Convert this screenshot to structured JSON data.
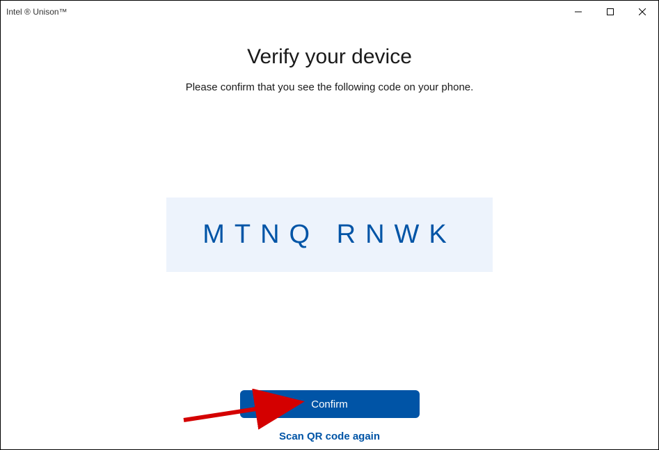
{
  "window": {
    "title": "Intel ® Unison™"
  },
  "main": {
    "heading": "Verify your device",
    "subheading": "Please confirm that you see the following code on your phone.",
    "verification_code": "MTNQ RNWK",
    "confirm_label": "Confirm",
    "scan_link_label": "Scan QR code again"
  },
  "colors": {
    "primary": "#0054a6",
    "code_bg": "#edf3fc"
  }
}
